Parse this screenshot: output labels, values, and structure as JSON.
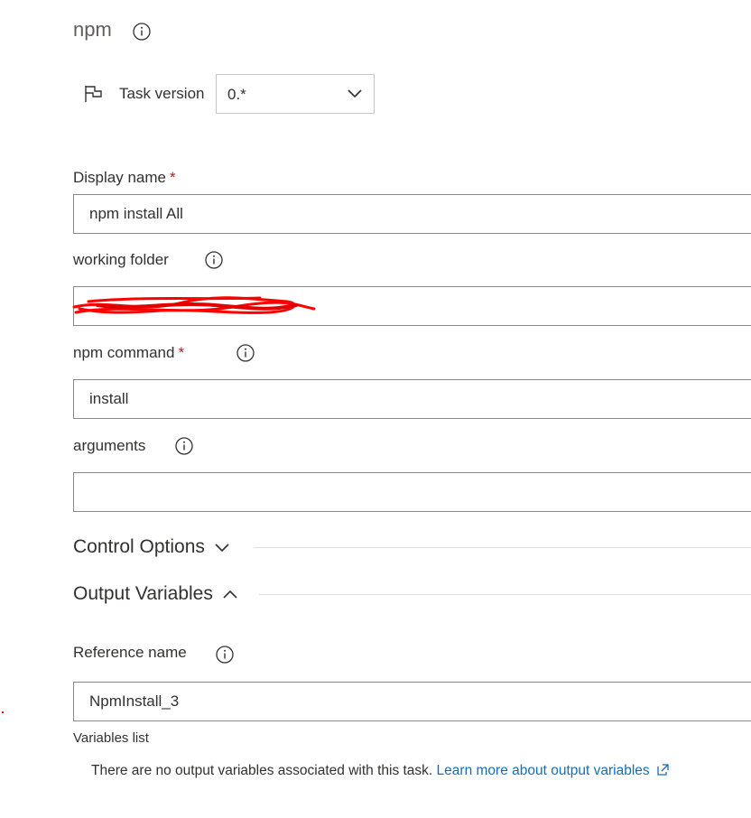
{
  "task": {
    "title": "npm",
    "version_label": "Task version",
    "version_value": "0.*"
  },
  "fields": {
    "display_name": {
      "label": "Display name",
      "required_mark": "*",
      "value": "npm install All"
    },
    "working_folder": {
      "label": "working folder",
      "value": ""
    },
    "npm_command": {
      "label": "npm command",
      "required_mark": "*",
      "value": "install"
    },
    "arguments": {
      "label": "arguments",
      "value": ""
    }
  },
  "sections": {
    "control_options": "Control Options",
    "output_variables": "Output Variables"
  },
  "output": {
    "reference_label": "Reference name",
    "reference_value": "NpmInstall_3",
    "variables_list_label": "Variables list",
    "no_vars_text": "There are no output variables associated with this task.",
    "learn_more_link": "Learn more about output variables"
  },
  "colors": {
    "accent_link": "#106ebe",
    "required": "#a4262c",
    "redaction": "#ff0000"
  },
  "icons": [
    "info-icon",
    "flag-icon",
    "chevron-down-icon",
    "chevron-up-icon",
    "external-link-icon"
  ]
}
